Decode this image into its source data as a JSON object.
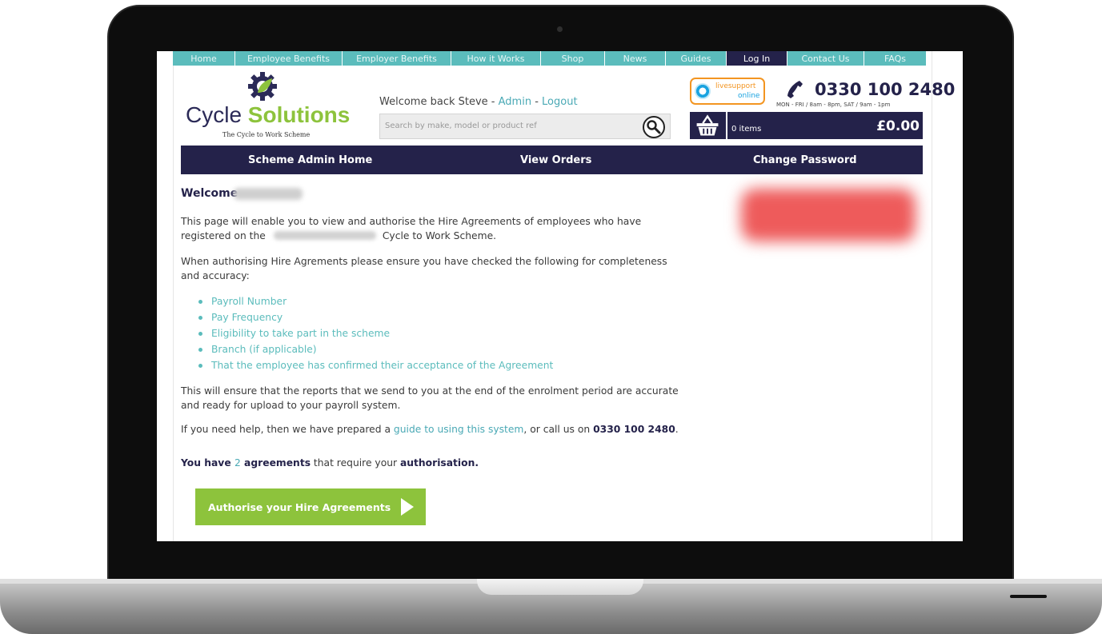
{
  "top_nav": [
    {
      "label": "Home",
      "active": false
    },
    {
      "label": "Employee Benefits",
      "active": false
    },
    {
      "label": "Employer Benefits",
      "active": false
    },
    {
      "label": "How it Works",
      "active": false
    },
    {
      "label": "Shop",
      "active": false
    },
    {
      "label": "News",
      "active": false
    },
    {
      "label": "Guides",
      "active": false
    },
    {
      "label": "Log In",
      "active": true
    },
    {
      "label": "Contact Us",
      "active": false
    },
    {
      "label": "FAQs",
      "active": false
    }
  ],
  "brand": {
    "name_part1": "Cycle ",
    "name_part2": "Solutions",
    "tagline": "The Cycle to Work Scheme"
  },
  "header": {
    "welcome_prefix": "Welcome back Steve - ",
    "admin_link": "Admin",
    "separator": " - ",
    "logout_link": "Logout",
    "search_placeholder": "Search by make, model or product ref",
    "live_support_line1": "livesupport",
    "live_support_line2": "online",
    "phone": "0330 100 2480",
    "hours": "MON - FRI / 8am - 8pm, SAT / 9am - 1pm",
    "basket_items": "0 items",
    "basket_total": "£0.00"
  },
  "admin_nav": {
    "home": "Scheme Admin Home",
    "orders": "View Orders",
    "password": "Change Password"
  },
  "content": {
    "welcome_heading": "Welcome",
    "intro_line1": "This page will enable you to view and authorise the Hire Agreements of employees who have",
    "intro_line2_a": "registered on the",
    "intro_line2_b": "Cycle to Work Scheme.",
    "check_line1": "When authorising Hire Agrements please ensure you have checked the following for completeness",
    "check_line2": "and accuracy:",
    "checklist": [
      "Payroll Number",
      "Pay Frequency",
      "Eligibility to take part in the scheme",
      "Branch (if applicable)",
      "That the employee has confirmed their acceptance of the Agreement"
    ],
    "reports_line1": "This will ensure that the reports that we send to you at the end of the enrolment period are accurate",
    "reports_line2": "and ready for upload to your payroll system.",
    "help_prefix": "If you need help, then we have prepared a ",
    "help_link": "guide to using this system",
    "help_middle": ", or call us on ",
    "help_phone": "0330 100 2480",
    "help_suffix": ".",
    "agreements_prefix": "You have ",
    "agreements_count": "2",
    "agreements_word": " agreements",
    "agreements_middle": " that require your ",
    "agreements_end": "authorisation.",
    "cta_label": "Authorise your Hire Agreements"
  },
  "colors": {
    "teal": "#5bbcbc",
    "navy": "#24224a",
    "green": "#8dc33c",
    "orange": "#f39521"
  }
}
